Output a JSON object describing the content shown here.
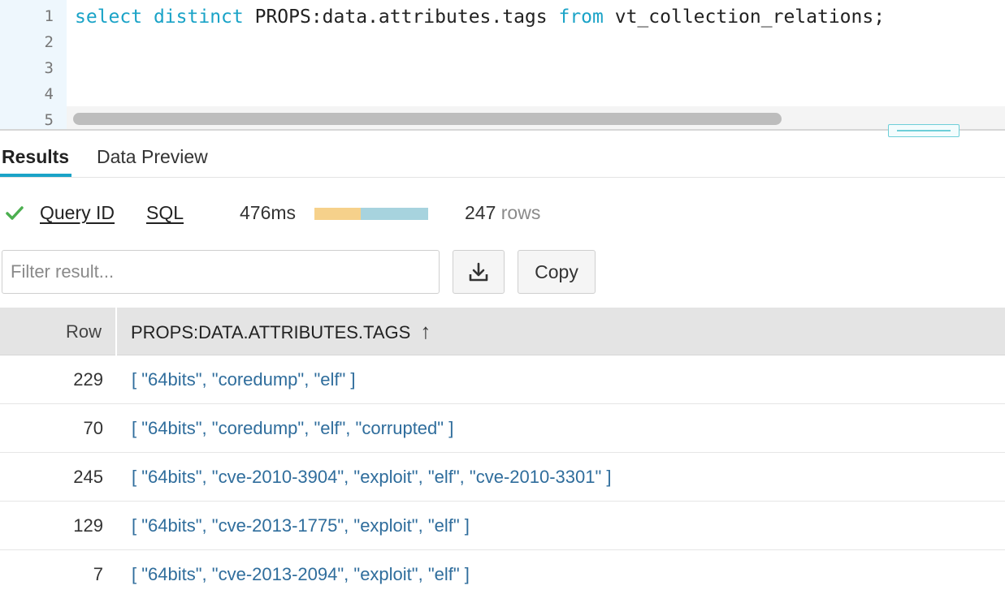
{
  "editor": {
    "line_numbers": [
      "1",
      "2",
      "3",
      "4",
      "5"
    ],
    "code": {
      "kw_select": "select",
      "kw_distinct": "distinct",
      "expr": "PROPS:data.attributes.tags",
      "kw_from": "from",
      "table": "vt_collection_relations;"
    }
  },
  "tabs": {
    "results": "Results",
    "data_preview": "Data Preview"
  },
  "status": {
    "query_id": "Query ID",
    "sql": "SQL",
    "duration": "476ms",
    "row_count": "247",
    "rows_label": "rows",
    "bar_segments": [
      {
        "share": 0.41,
        "color": "#f6d18b"
      },
      {
        "share": 0.59,
        "color": "#a7d3de"
      }
    ],
    "check_color": "#4caf50"
  },
  "filter": {
    "placeholder": "Filter result...",
    "value": ""
  },
  "actions": {
    "download_icon": "download-icon",
    "copy": "Copy"
  },
  "table": {
    "headers": {
      "row": "Row",
      "column": "PROPS:DATA.ATTRIBUTES.TAGS",
      "sort_icon": "↑"
    },
    "rows": [
      {
        "row": "229",
        "value": "[ \"64bits\", \"coredump\", \"elf\" ]"
      },
      {
        "row": "70",
        "value": "[ \"64bits\", \"coredump\", \"elf\", \"corrupted\" ]"
      },
      {
        "row": "245",
        "value": "[ \"64bits\", \"cve-2010-3904\", \"exploit\", \"elf\", \"cve-2010-3301\" ]"
      },
      {
        "row": "129",
        "value": "[ \"64bits\", \"cve-2013-1775\", \"exploit\", \"elf\" ]"
      },
      {
        "row": "7",
        "value": "[ \"64bits\", \"cve-2013-2094\", \"exploit\", \"elf\" ]"
      }
    ]
  }
}
